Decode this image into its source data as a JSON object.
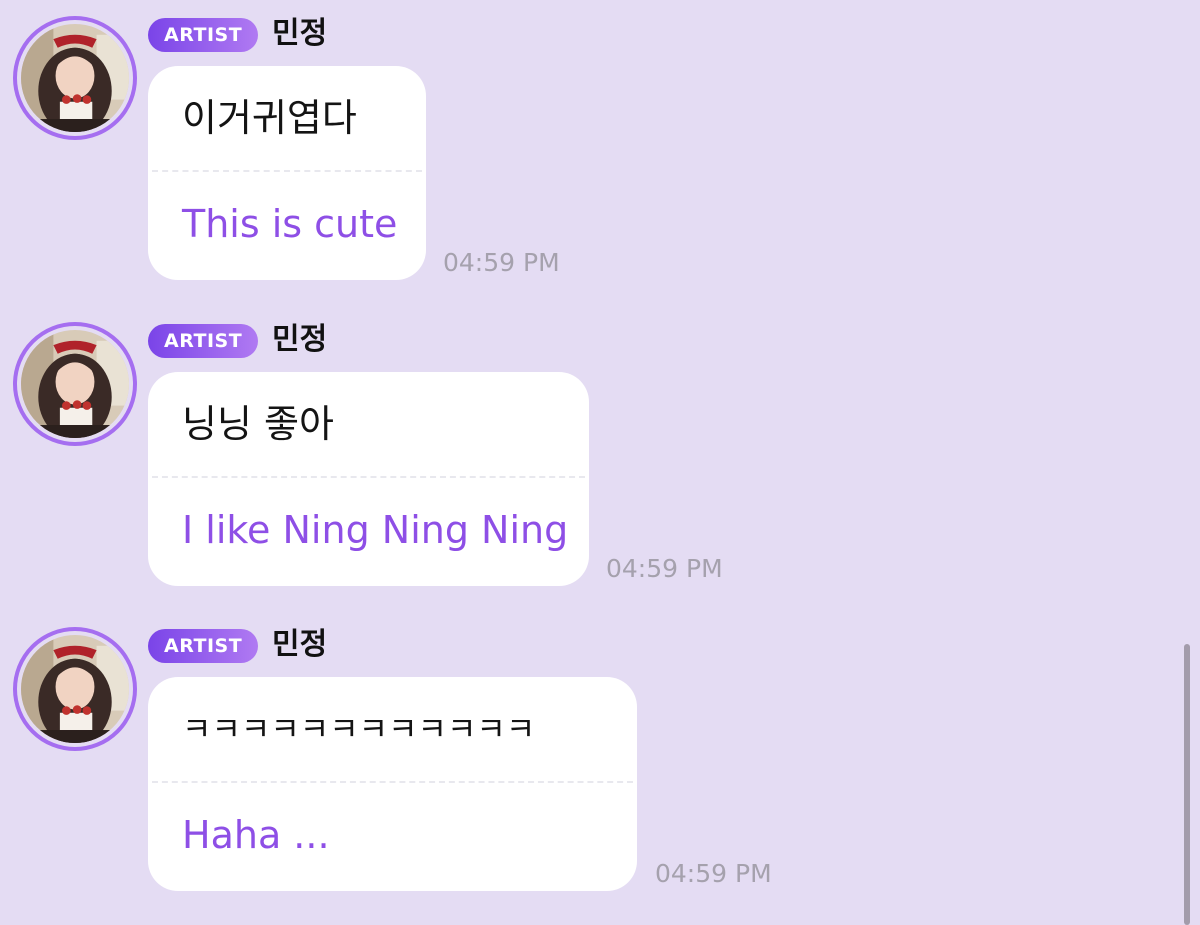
{
  "messages": [
    {
      "badge": "ARTIST",
      "name": "민정",
      "original": "이거귀엽다",
      "translation": "This is cute",
      "time": "04:59 PM"
    },
    {
      "badge": "ARTIST",
      "name": "민정",
      "original": "닝닝 좋아",
      "translation": "I like Ning Ning Ning",
      "time": "04:59 PM"
    },
    {
      "badge": "ARTIST",
      "name": "민정",
      "original": "ㅋㅋㅋㅋㅋㅋㅋㅋㅋㅋㅋㅋ",
      "translation": "Haha ...",
      "time": "04:59 PM"
    }
  ],
  "colors": {
    "background": "#e4dcf3",
    "badge_gradient_start": "#7a44e8",
    "badge_gradient_end": "#b07af2",
    "translation_text": "#8e4fe6",
    "timestamp": "#a5a1ad"
  },
  "icons": {
    "avatar": "profile-photo"
  }
}
